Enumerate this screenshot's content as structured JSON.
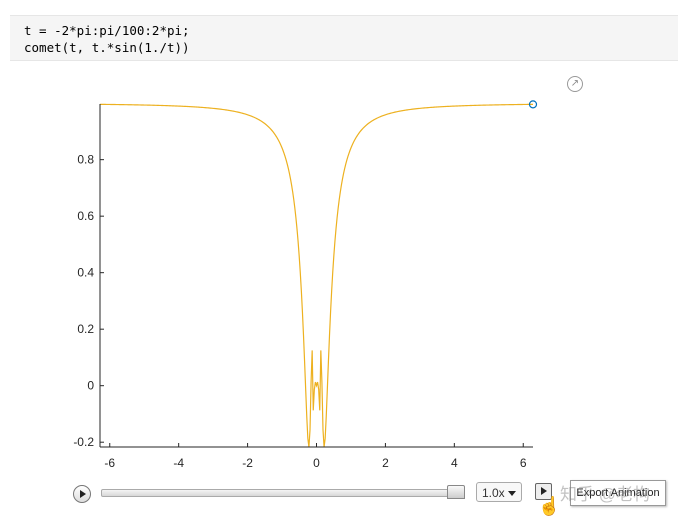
{
  "code": {
    "lines": [
      "t = -2*pi:pi/100:2*pi;",
      "comet(t, t.*sin(1./t))"
    ]
  },
  "controls": {
    "speed": "1.0x",
    "tooltip": "Export Animation",
    "playback_progress": 1.0
  },
  "watermark": "知乎 @老构",
  "colors": {
    "line": "#EDB120",
    "marker": "#0072BD"
  },
  "chart_data": {
    "type": "line",
    "title": "",
    "xlabel": "",
    "ylabel": "",
    "function": "t.*sin(1./t)",
    "x_start": -6.2832,
    "x_end": 6.2832,
    "x_step": 0.031416,
    "xlim": [
      -6.2832,
      6.2832
    ],
    "ylim": [
      -0.217,
      0.997
    ],
    "xticks": [
      -6,
      -4,
      -2,
      0,
      2,
      4,
      6
    ],
    "xtick_labels": [
      "-6",
      "-4",
      "-2",
      "0",
      "2",
      "4",
      "6"
    ],
    "yticks": [
      -0.2,
      0,
      0.2,
      0.4,
      0.6,
      0.8
    ],
    "ytick_labels": [
      "-0.2",
      "0",
      "0.2",
      "0.4",
      "0.6",
      "0.8"
    ],
    "grid": false,
    "head_marker": {
      "x": 6.2832,
      "y": 0.9958
    }
  }
}
